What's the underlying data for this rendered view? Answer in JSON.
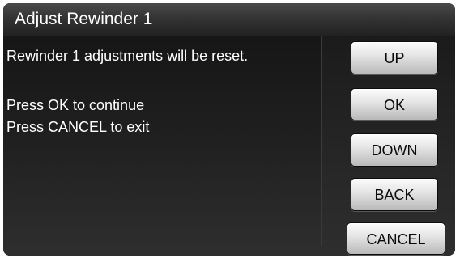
{
  "title_bar": {
    "title": "Adjust Rewinder 1"
  },
  "message": {
    "line1": "Rewinder 1 adjustments will be reset.",
    "line2": "Press OK to continue",
    "line3": "Press CANCEL to exit"
  },
  "buttons": {
    "up": "UP",
    "ok": "OK",
    "down": "DOWN",
    "back": "BACK",
    "cancel": "CANCEL"
  }
}
